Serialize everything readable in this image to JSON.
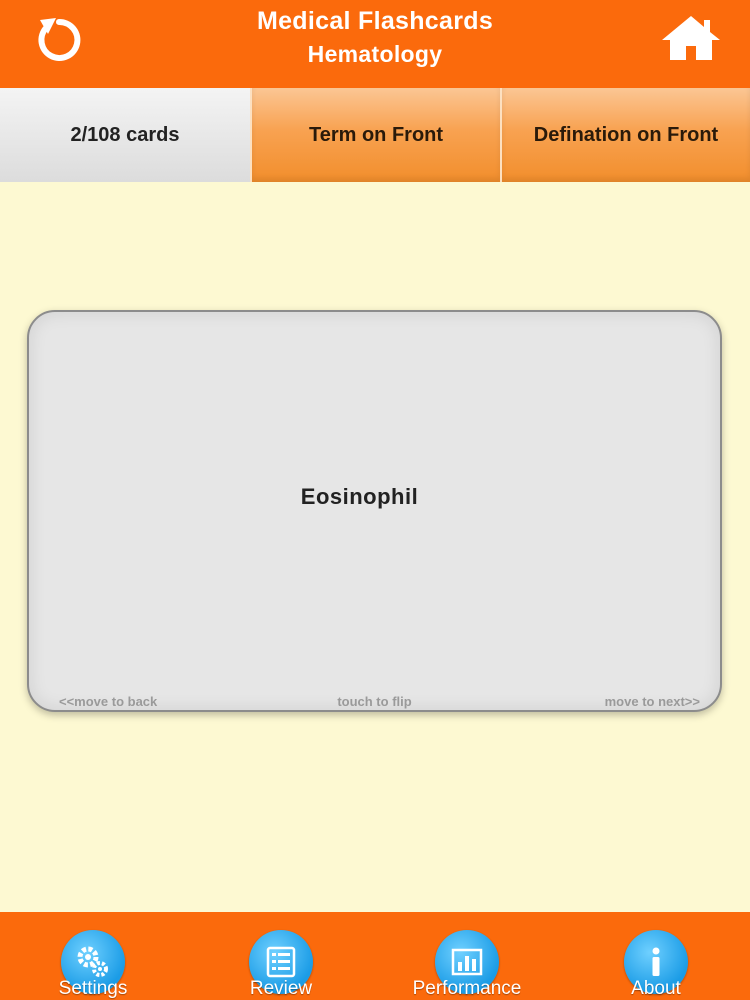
{
  "header": {
    "title": "Medical Flashcards",
    "subtitle": "Hematology",
    "background": "#fb6a0c"
  },
  "segments": {
    "count_label": "2/108 cards",
    "term_front_label": "Term on Front",
    "definition_front_label": "Defination on Front"
  },
  "card": {
    "term": "Eosinophil",
    "hint_back": "<<move to back",
    "hint_flip": "touch to flip",
    "hint_next": "move to next>>"
  },
  "tabbar": {
    "items": [
      {
        "label": "Settings",
        "icon": "gears-icon"
      },
      {
        "label": "Review",
        "icon": "list-icon"
      },
      {
        "label": "Performance",
        "icon": "bar-chart-icon"
      },
      {
        "label": "About",
        "icon": "info-icon"
      }
    ]
  },
  "colors": {
    "accent": "#fb6a0c",
    "background": "#fdf9d2",
    "tab_icon": "#1b9ce6"
  }
}
